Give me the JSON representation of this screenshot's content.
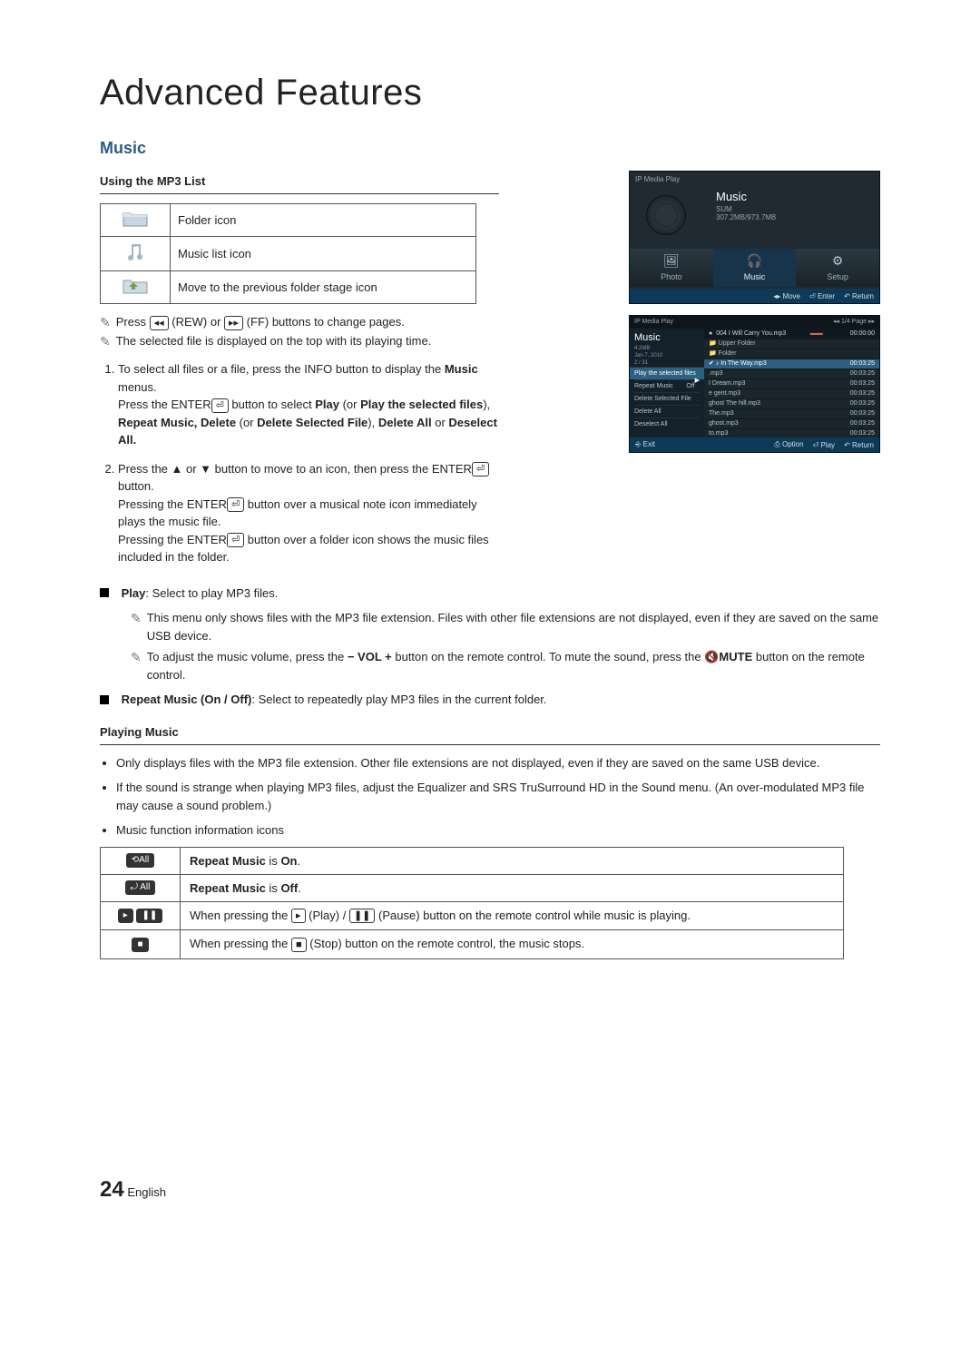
{
  "page_title": "Advanced Features",
  "section": "Music",
  "subhead1": "Using the MP3 List",
  "icon_table": [
    {
      "name": "folder-icon",
      "label": "Folder icon"
    },
    {
      "name": "music-list-icon",
      "label": "Music list icon"
    },
    {
      "name": "previous-folder-icon",
      "label": "Move to the previous folder stage icon"
    }
  ],
  "note1_pre": "Press ",
  "note1_rew": "◂◂",
  "note1_mid1": " (REW) or ",
  "note1_ff": "▸▸",
  "note1_post": " (FF) buttons to change pages.",
  "note2": "The selected file is displayed on the top with its playing time.",
  "step1_a": "To select all files or a file, press the INFO button to display the ",
  "step1_b": "Music",
  "step1_c": " menus.",
  "step1_d": "Press the ENTER",
  "step1_e": " button to select ",
  "step1_f": "Play",
  "step1_g": " (or ",
  "step1_h": "Play the selected files",
  "step1_i": "), ",
  "step1_j": "Repeat Music, Delete",
  "step1_k": " (or ",
  "step1_l": "Delete Selected File",
  "step1_m": "), ",
  "step1_n": "Delete All",
  "step1_o": " or ",
  "step1_p": "Deselect All.",
  "step2_a": "Press the ▲ or ▼ button to move to an icon, then press the ENTER",
  "step2_b": " button.",
  "step2_c": "Pressing the ENTER",
  "step2_d": " button over a musical note icon immediately plays the music file.",
  "step2_e": "Pressing the ENTER",
  "step2_f": " button over a folder icon shows the music files included in the folder.",
  "play_label": "Play",
  "play_desc": ": Select to play MP3 files.",
  "play_note1": "This menu only shows files with the MP3 file extension. Files with other file extensions are not displayed, even if they are saved on the same USB device.",
  "play_note2_a": "To adjust the music volume, press the ",
  "play_note2_vol": "− VOL +",
  "play_note2_b": " button on the remote control. To mute the sound, press the ",
  "play_note2_mute": "MUTE",
  "play_note2_c": " button on the remote control.",
  "repeat_label": "Repeat Music (On / Off)",
  "repeat_desc": ": Select to repeatedly play MP3 files in the current folder.",
  "playing_head": "Playing Music",
  "playing_bullets": [
    "Only displays files with the MP3 file extension. Other file extensions are not displayed, even if they are saved on the same USB device.",
    "If the sound is strange when playing MP3 files, adjust the Equalizer and SRS TruSurround HD in the Sound menu. (An over-modulated MP3 file may cause a sound problem.)",
    "Music function information icons"
  ],
  "status_table": {
    "r1_b": "Repeat Music",
    "r1_c": " is ",
    "r1_d": "On",
    "r2_b": "Repeat Music",
    "r2_c": " is ",
    "r2_d": "Off",
    "r3_a": "When pressing the ",
    "r3_play": "▸",
    "r3_b": " (Play) / ",
    "r3_pause": "❚❚",
    "r3_c": " (Pause) button on the remote control while music is playing.",
    "r4_a": "When pressing the ",
    "r4_stop": "■",
    "r4_b": " (Stop) button on the remote control, the music stops."
  },
  "tv1": {
    "crumb": "IP Media Play",
    "title": "Music",
    "sub1": "SUM",
    "sub2": "307.2MB/973.7MB",
    "tabs": [
      "Photo",
      "Music",
      "Setup"
    ],
    "bar": {
      "move": "◂▸ Move",
      "enter": "⏎ Enter",
      "return": "↶ Return"
    }
  },
  "tv2": {
    "crumb": "IP Media Play",
    "pager": "◂◂  1/4 Page  ▸▸",
    "side_title": "Music",
    "side_meta1": "4.2MB",
    "side_meta2": "Jan 7, 2010",
    "side_meta3": "2 / 31",
    "options": [
      {
        "label": "Play the selected files",
        "sel": true,
        "right": "▶"
      },
      {
        "label": "Repeat Music",
        "right": "Off"
      },
      {
        "label": "Delete Selected File"
      },
      {
        "label": "Delete All"
      },
      {
        "label": "Deselect All"
      }
    ],
    "toprow": {
      "file": "004 I Will Carry You.mp3",
      "time": "00:00:00"
    },
    "rows": [
      {
        "name": "Upper Folder",
        "time": ""
      },
      {
        "name": "Folder",
        "time": ""
      },
      {
        "name": "In The Way.mp3",
        "time": "00:03:25",
        "sel": true
      },
      {
        "name": ".mp3",
        "time": "00:03:25"
      },
      {
        "name": "I Dream.mp3",
        "time": "00:03:25"
      },
      {
        "name": "e gent.mp3",
        "time": "00:03:25"
      },
      {
        "name": "ghost The hill.mp3",
        "time": "00:03:25"
      },
      {
        "name": "The.mp3",
        "time": "00:03:25"
      },
      {
        "name": "ghost.mp3",
        "time": "00:03:25"
      },
      {
        "name": "to.mp3",
        "time": "00:03:25"
      }
    ],
    "bar": {
      "exit": "⎆ Exit",
      "option": "⎙ Option",
      "play": "⏎ Play",
      "return": "↶ Return"
    }
  },
  "footer": {
    "num": "24",
    "lang": "English"
  },
  "badges": {
    "all_on": "⟲All",
    "all_off": "⤾ All"
  }
}
